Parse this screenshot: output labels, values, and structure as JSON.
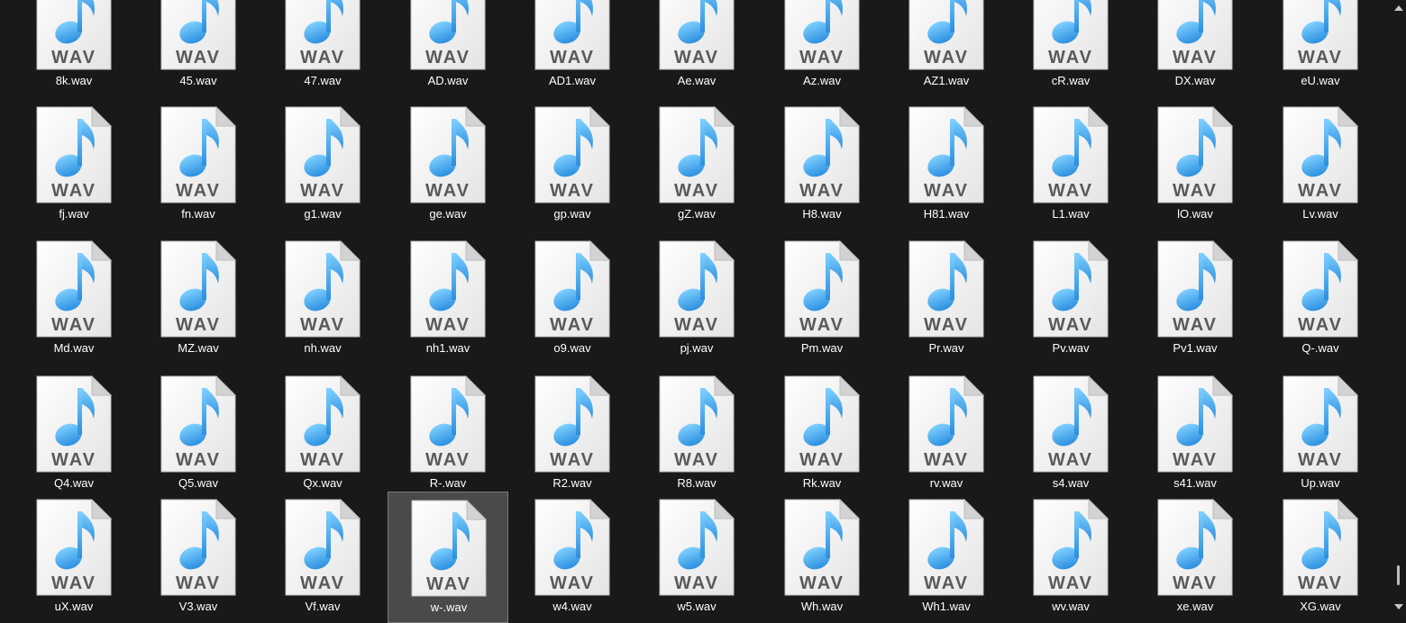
{
  "files": [
    "8k.wav",
    "45.wav",
    "47.wav",
    "AD.wav",
    "AD1.wav",
    "Ae.wav",
    "Az.wav",
    "AZ1.wav",
    "cR.wav",
    "DX.wav",
    "eU.wav",
    "fj.wav",
    "fn.wav",
    "g1.wav",
    "ge.wav",
    "gp.wav",
    "gZ.wav",
    "H8.wav",
    "H81.wav",
    "L1.wav",
    "lO.wav",
    "Lv.wav",
    "Md.wav",
    "MZ.wav",
    "nh.wav",
    "nh1.wav",
    "o9.wav",
    "pj.wav",
    "Pm.wav",
    "Pr.wav",
    "Pv.wav",
    "Pv1.wav",
    "Q-.wav",
    "Q4.wav",
    "Q5.wav",
    "Qx.wav",
    "R-.wav",
    "R2.wav",
    "R8.wav",
    "Rk.wav",
    "rv.wav",
    "s4.wav",
    "s41.wav",
    "Up.wav",
    "uX.wav",
    "V3.wav",
    "Vf.wav",
    "w-.wav",
    "w4.wav",
    "w5.wav",
    "Wh.wav",
    "Wh1.wav",
    "wv.wav",
    "xe.wav",
    "XG.wav"
  ],
  "icon": {
    "name": "wav-file-icon",
    "label": "WAV",
    "note_color": "#2c8fdf",
    "label_color": "#5a5a5a"
  },
  "selected_index": 47,
  "colors": {
    "background": "#191919",
    "text": "#ffffff",
    "selection_fill": "#4a4a4a",
    "selection_border": "#7a7a7a"
  }
}
